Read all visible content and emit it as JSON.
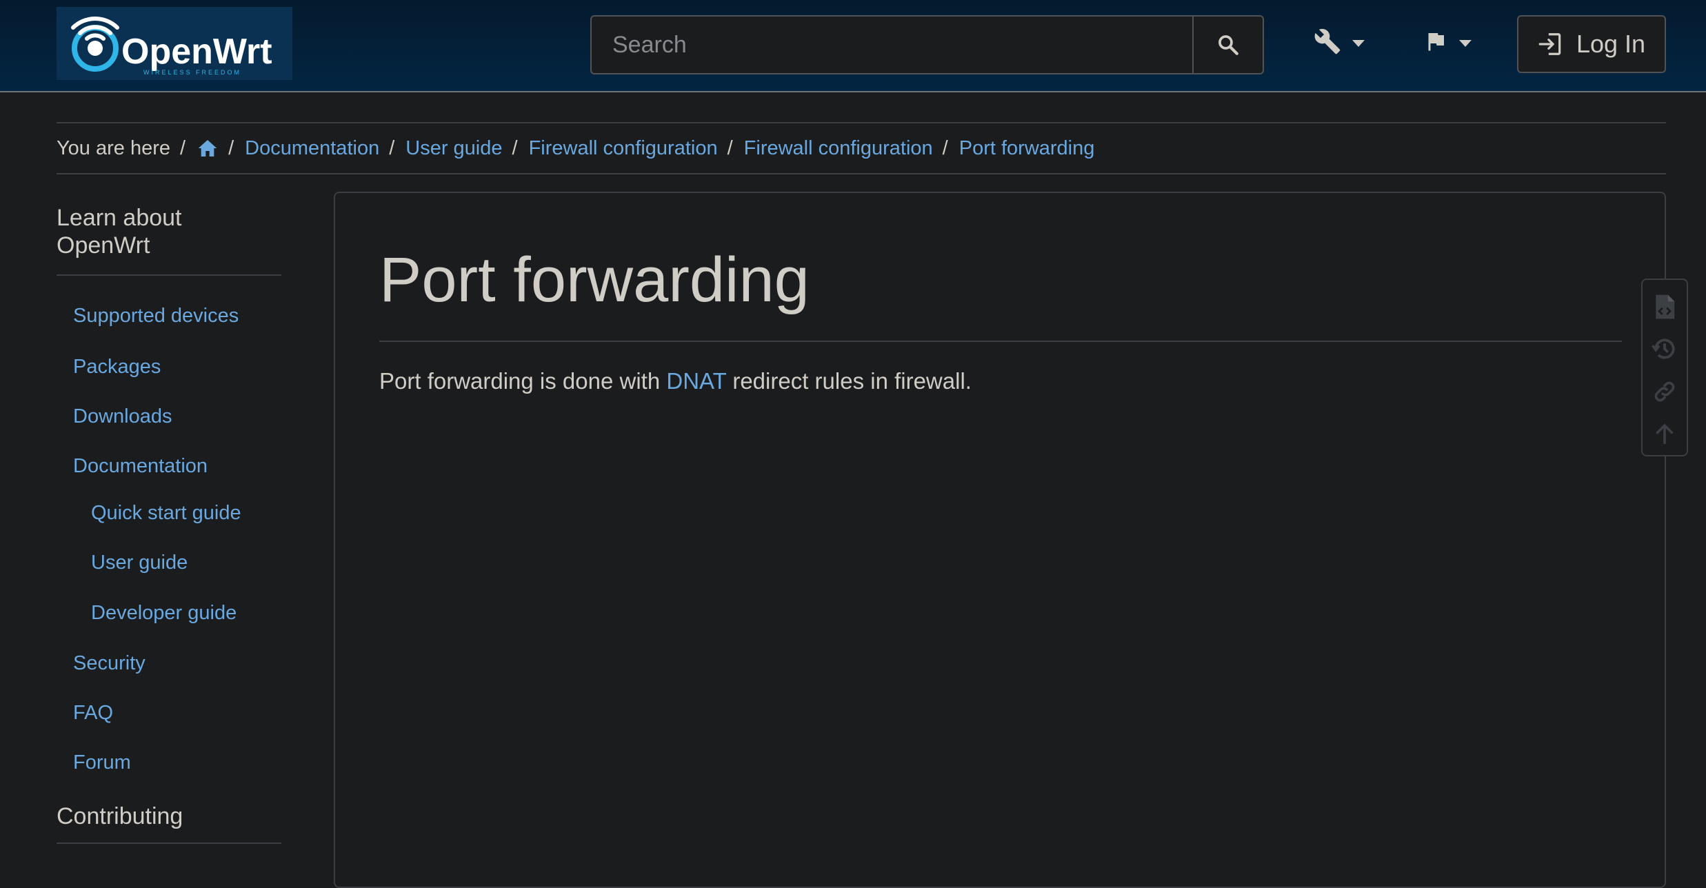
{
  "header": {
    "logo": {
      "text": "OpenWrt",
      "tagline": "WIRELESS FREEDOM",
      "icon": "openwrt-wifi-logo"
    },
    "search": {
      "placeholder": "Search",
      "icon": "search-icon"
    },
    "tools_menu_icon": "wrench-icon",
    "language_menu_icon": "flag-icon",
    "login": {
      "label": "Log In",
      "icon": "login-icon"
    }
  },
  "breadcrumb": {
    "prefix": "You are here",
    "home_icon": "home-icon",
    "separator": "/",
    "items": [
      {
        "label": "Documentation"
      },
      {
        "label": "User guide"
      },
      {
        "label": "Firewall configuration"
      },
      {
        "label": "Firewall configuration"
      },
      {
        "label": "Port forwarding"
      }
    ]
  },
  "sidebar": {
    "heading": "Learn about OpenWrt",
    "items": [
      {
        "label": "Supported devices"
      },
      {
        "label": "Packages"
      },
      {
        "label": "Downloads"
      },
      {
        "label": "Documentation"
      },
      {
        "label": "Quick start guide"
      },
      {
        "label": "User guide"
      },
      {
        "label": "Developer guide"
      },
      {
        "label": "Security"
      },
      {
        "label": "FAQ"
      },
      {
        "label": "Forum"
      }
    ],
    "heading2": "Contributing"
  },
  "content": {
    "title": "Port forwarding",
    "intro_before": "Port forwarding is done with ",
    "intro_link": "DNAT",
    "intro_after": " redirect rules in firewall."
  },
  "pagetools": [
    {
      "icon": "source-file-icon"
    },
    {
      "icon": "history-icon"
    },
    {
      "icon": "link-icon"
    },
    {
      "icon": "arrow-up-icon"
    }
  ],
  "colors": {
    "background": "#1b1c1e",
    "navbar": "#032542",
    "link": "#6aa8e0",
    "text": "#d0ccc6",
    "border": "#3b3e43"
  }
}
